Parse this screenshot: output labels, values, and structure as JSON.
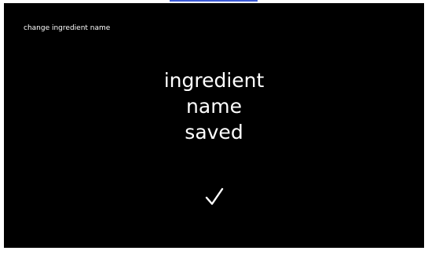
{
  "header": {
    "title": "change ingredient name"
  },
  "message": {
    "lines": [
      "ingredient",
      "name",
      "saved"
    ]
  },
  "icons": {
    "confirmation": "check-icon"
  },
  "colors": {
    "background": "#000000",
    "text": "#ffffff",
    "top_link_line": "#3c5bd6"
  }
}
